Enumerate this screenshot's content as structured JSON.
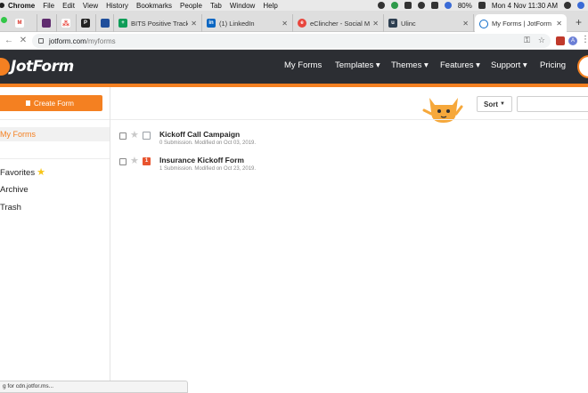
{
  "menubar": {
    "items": [
      "Chrome",
      "File",
      "Edit",
      "View",
      "History",
      "Bookmarks",
      "People",
      "Tab",
      "Window",
      "Help"
    ],
    "battery": "80%",
    "clock": "Mon 4 Nov  11:30 AM"
  },
  "tabs": [
    {
      "title": "",
      "favicon_color": "#d93025",
      "favicon_text": "M"
    },
    {
      "title": "",
      "favicon_color": "#5f2b6e",
      "favicon_text": ""
    },
    {
      "title": "",
      "favicon_color": "#e8453c",
      "favicon_text": ""
    },
    {
      "title": "",
      "favicon_color": "#222222",
      "favicon_text": "P"
    },
    {
      "title": "",
      "favicon_color": "#1f4e9b",
      "favicon_text": ""
    },
    {
      "title": "BITS Positive Tracke",
      "favicon_color": "#0f9d58",
      "favicon_text": "+"
    },
    {
      "title": "(1) LinkedIn",
      "favicon_color": "#0a66c2",
      "favicon_text": "in"
    },
    {
      "title": "eClincher - Social Me",
      "favicon_color": "#e8453c",
      "favicon_text": "e"
    },
    {
      "title": "Ulinc",
      "favicon_color": "#2d3e50",
      "favicon_text": "u"
    },
    {
      "title": "My Forms | JotForm",
      "favicon_color": "#0a6ac9",
      "favicon_text": "",
      "active": true
    }
  ],
  "address": {
    "url_host": "jotform.com",
    "url_path": "/myforms"
  },
  "jotform": {
    "logo_text": "JotForm",
    "nav": [
      "My Forms",
      "Templates ▾",
      "Themes ▾",
      "Features ▾",
      "Support ▾",
      "Pricing"
    ],
    "accent_color": "#f48021"
  },
  "sidebar": {
    "create_label": "Create Form",
    "my_forms_label": "My Forms",
    "favorites_label": "Favorites",
    "archive_label": "Archive",
    "trash_label": "Trash"
  },
  "toolbar": {
    "sort_label": "Sort"
  },
  "forms": [
    {
      "title": "Kickoff Call Campaign",
      "meta": "0 Submission. Modified on Oct 03, 2019.",
      "badge": "",
      "icon_color": "#9aa0a6"
    },
    {
      "title": "Insurance Kickoff Form",
      "meta": "1 Submission. Modified on Oct 23, 2019.",
      "badge": "1",
      "icon_color": "#e8542f"
    }
  ],
  "status_text": "g for cdn.jotfor.ms..."
}
